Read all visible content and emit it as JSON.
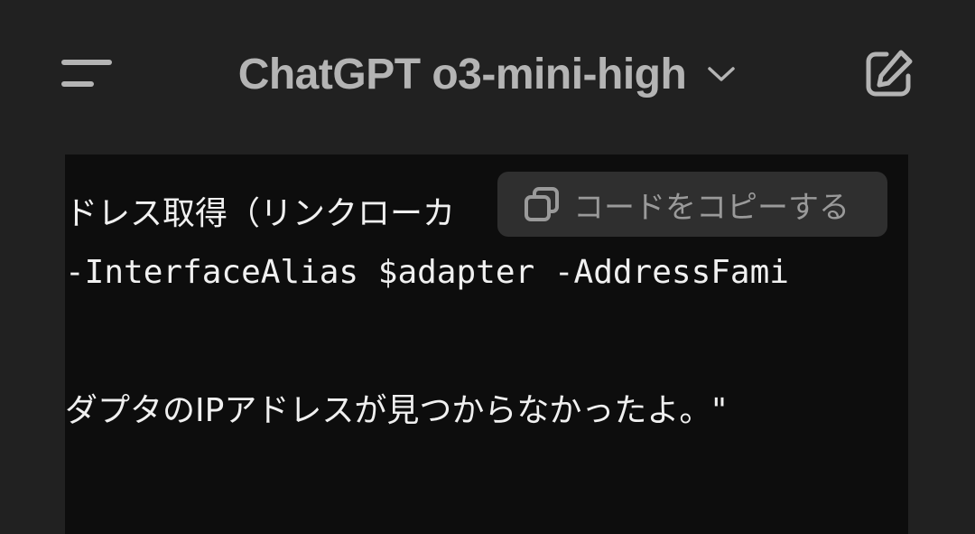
{
  "header": {
    "title": "ChatGPT o3-mini-high",
    "menu_icon": "menu-icon",
    "dropdown_icon": "chevron-down-icon",
    "edit_icon": "new-chat-icon"
  },
  "code": {
    "lines": [
      "ドレス取得（リンクローカ",
      "-InterfaceAlias $adapter -AddressFami",
      "ダプタのIPアドレスが見つからなかったよ。\""
    ]
  },
  "copy_button": {
    "label": "コードをコピーする",
    "icon": "copy-icon"
  },
  "colors": {
    "background": "#212121",
    "code_background": "#0d0d0d",
    "header_text": "#b4b4b4",
    "copy_button_bg": "#2f2f2f"
  }
}
